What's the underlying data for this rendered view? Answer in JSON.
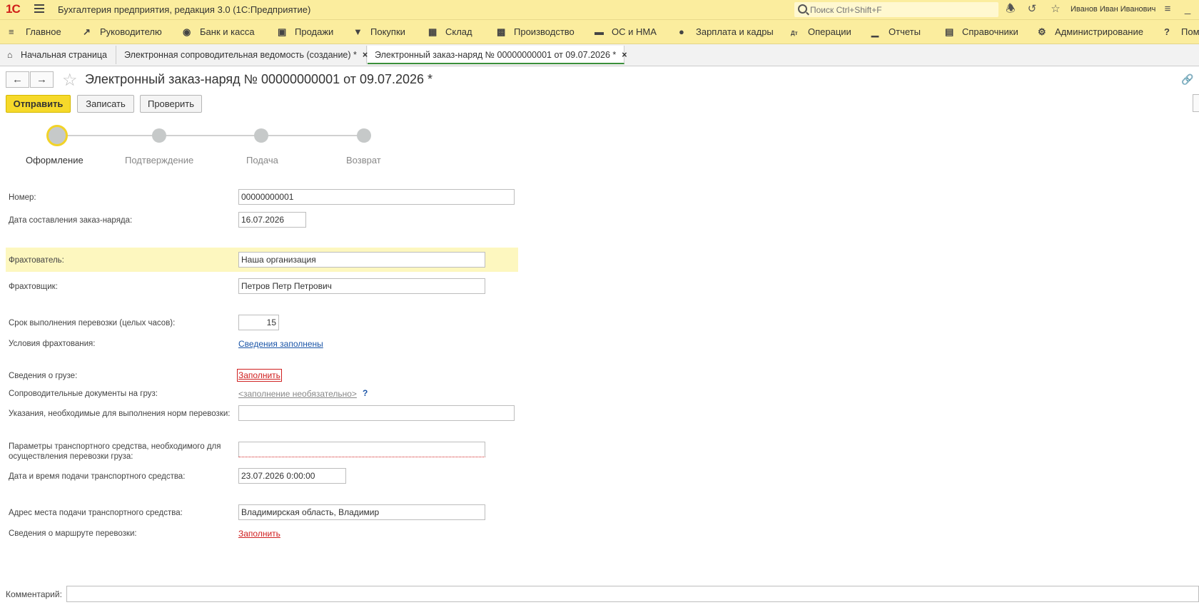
{
  "app": {
    "logo": "1С",
    "title": "Бухгалтерия предприятия, редакция 3.0  (1С:Предприятие)",
    "search_placeholder": "Поиск Ctrl+Shift+F",
    "user": "Иванов Иван Иванович"
  },
  "sections": [
    {
      "label": "Главное",
      "icon": "hamburger-icon"
    },
    {
      "label": "Руководителю",
      "icon": "trend-icon"
    },
    {
      "label": "Банк и касса",
      "icon": "coin-icon"
    },
    {
      "label": "Продажи",
      "icon": "bag-icon"
    },
    {
      "label": "Покупки",
      "icon": "cart-icon"
    },
    {
      "label": "Склад",
      "icon": "warehouse-icon"
    },
    {
      "label": "Производство",
      "icon": "factory-icon"
    },
    {
      "label": "ОС и НМА",
      "icon": "truck-icon"
    },
    {
      "label": "Зарплата и кадры",
      "icon": "person-icon"
    },
    {
      "label": "Операции",
      "icon": "dt-kt-icon"
    },
    {
      "label": "Отчеты",
      "icon": "bar-chart-icon"
    },
    {
      "label": "Справочники",
      "icon": "books-icon"
    },
    {
      "label": "Администрирование",
      "icon": "gear-icon"
    },
    {
      "label": "Пом",
      "icon": "help-icon"
    }
  ],
  "tabs": {
    "home": "Начальная страница",
    "tab1": "Электронная сопроводительная ведомость (создание) *",
    "tab2": "Электронный заказ-наряд № 00000000001 от 09.07.2026 *",
    "close": "×"
  },
  "form": {
    "title": "Электронный заказ-наряд № 00000000001 от 09.07.2026 *",
    "buttons": {
      "send": "Отправить",
      "save": "Записать",
      "check": "Проверить"
    },
    "steps": [
      "Оформление",
      "Подтверждение",
      "Подача",
      "Возврат"
    ],
    "fields": {
      "number_label": "Номер:",
      "number_value": "00000000001",
      "date_label": "Дата составления заказ-наряда:",
      "date_value": "16.07.2026",
      "charterer_label": "Фрахтователь:",
      "charterer_value": "Наша организация",
      "carrier_label": "Фрахтовщик:",
      "carrier_value": "Петров Петр Петрович",
      "term_label": "Срок выполнения перевозки (целых часов):",
      "term_value": "15",
      "conditions_label": "Условия фрахтования:",
      "conditions_link": "Сведения заполнены",
      "cargo_label": "Сведения о грузе:",
      "cargo_link": "Заполнить",
      "docs_label": "Сопроводительные документы на груз:",
      "docs_link": "<заполнение необязательно>",
      "docs_help": "?",
      "instructions_label": "Указания, необходимые для выполнения норм перевозки:",
      "instructions_value": "",
      "vehicle_label_1": "Параметры транспортного средства, необходимого для",
      "vehicle_label_2": "осуществления перевозки груза:",
      "vehicle_value": "",
      "delivery_dt_label": "Дата и время подачи транспортного средства:",
      "delivery_dt_value": "23.07.2026  0:00:00",
      "address_label": "Адрес места подачи транспортного средства:",
      "address_value": "Владимирская область, Владимир",
      "route_label": "Сведения о маршруте перевозки:",
      "route_link": "Заполнить"
    },
    "comment_label": "Комментарий:",
    "comment_value": ""
  },
  "colors": {
    "panel": "#fbed9e",
    "primary_button": "#f6d92a",
    "highlight_row": "#fdf7bf",
    "link_blue": "#1c56a8",
    "link_red": "#d02020",
    "active_tab_underline": "#3a8f3a"
  }
}
